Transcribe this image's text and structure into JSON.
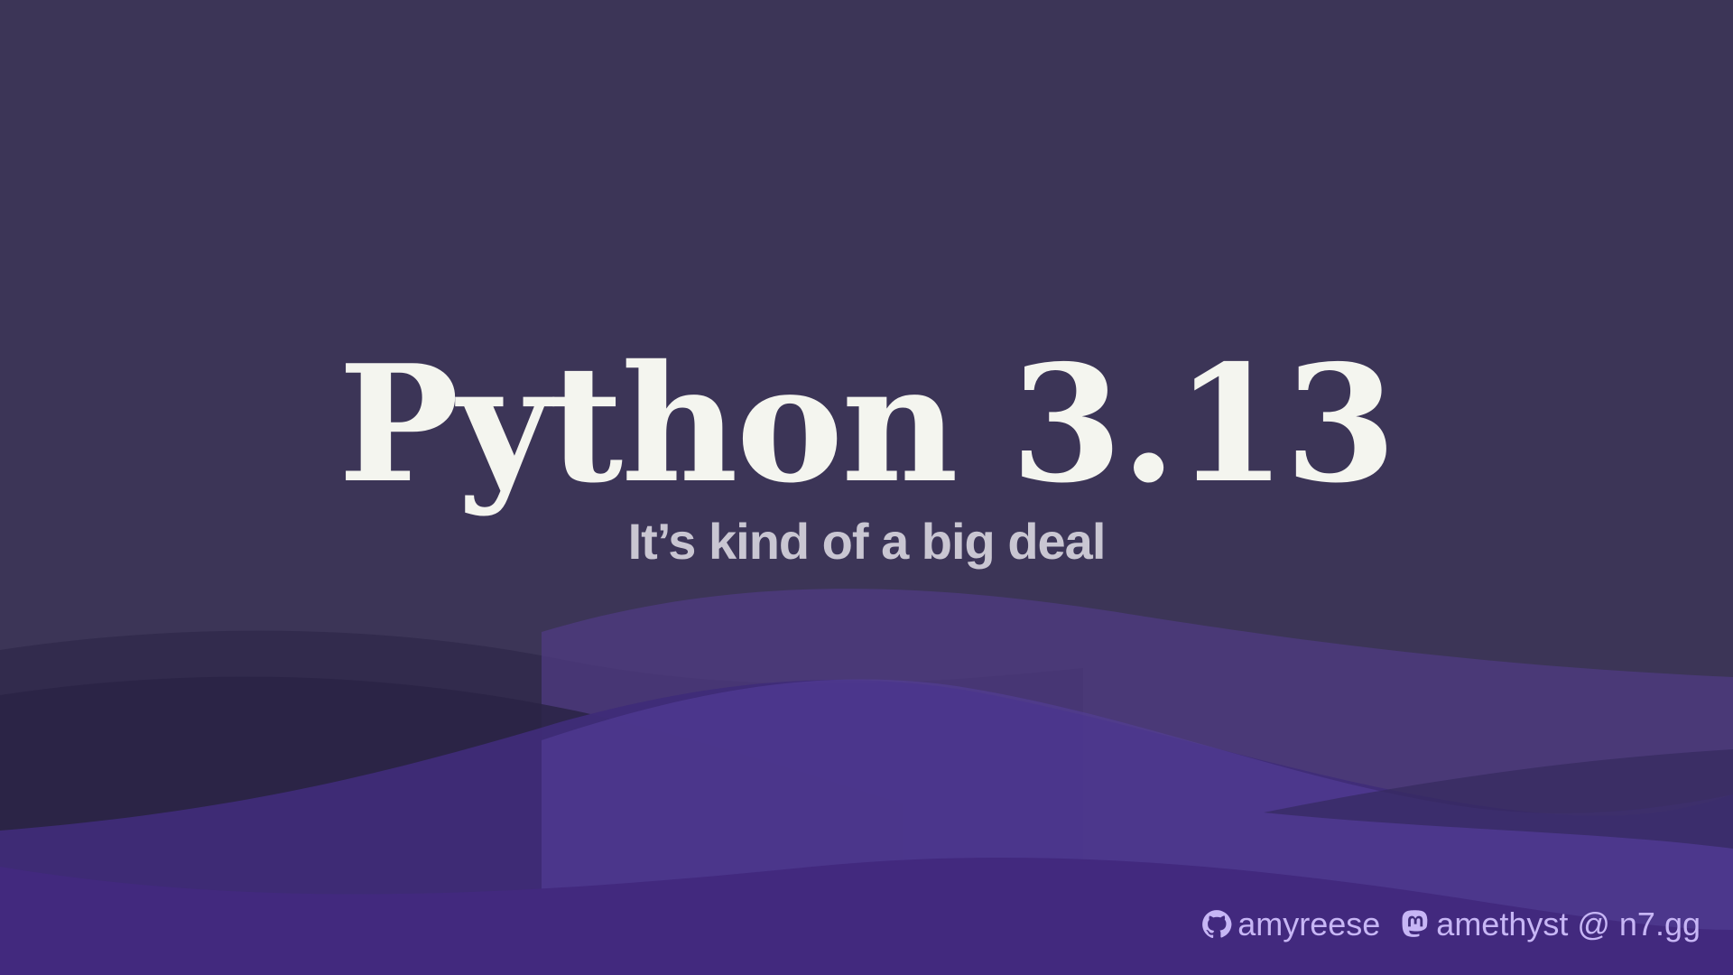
{
  "slide": {
    "title": "Python 3.13",
    "subtitle": "It’s kind of a big deal"
  },
  "footer": {
    "github": {
      "icon": "github-icon",
      "handle": "amyreese"
    },
    "mastodon": {
      "icon": "mastodon-icon",
      "handle": "amethyst @ n7.gg"
    }
  },
  "colors": {
    "background": "#3c3557",
    "title": "#f4f5ef",
    "subtitle": "#c9c6d2",
    "footer_text": "#c7b6f5",
    "wave_purple": "#5b3ea3",
    "wave_dark": "#2a2345"
  }
}
